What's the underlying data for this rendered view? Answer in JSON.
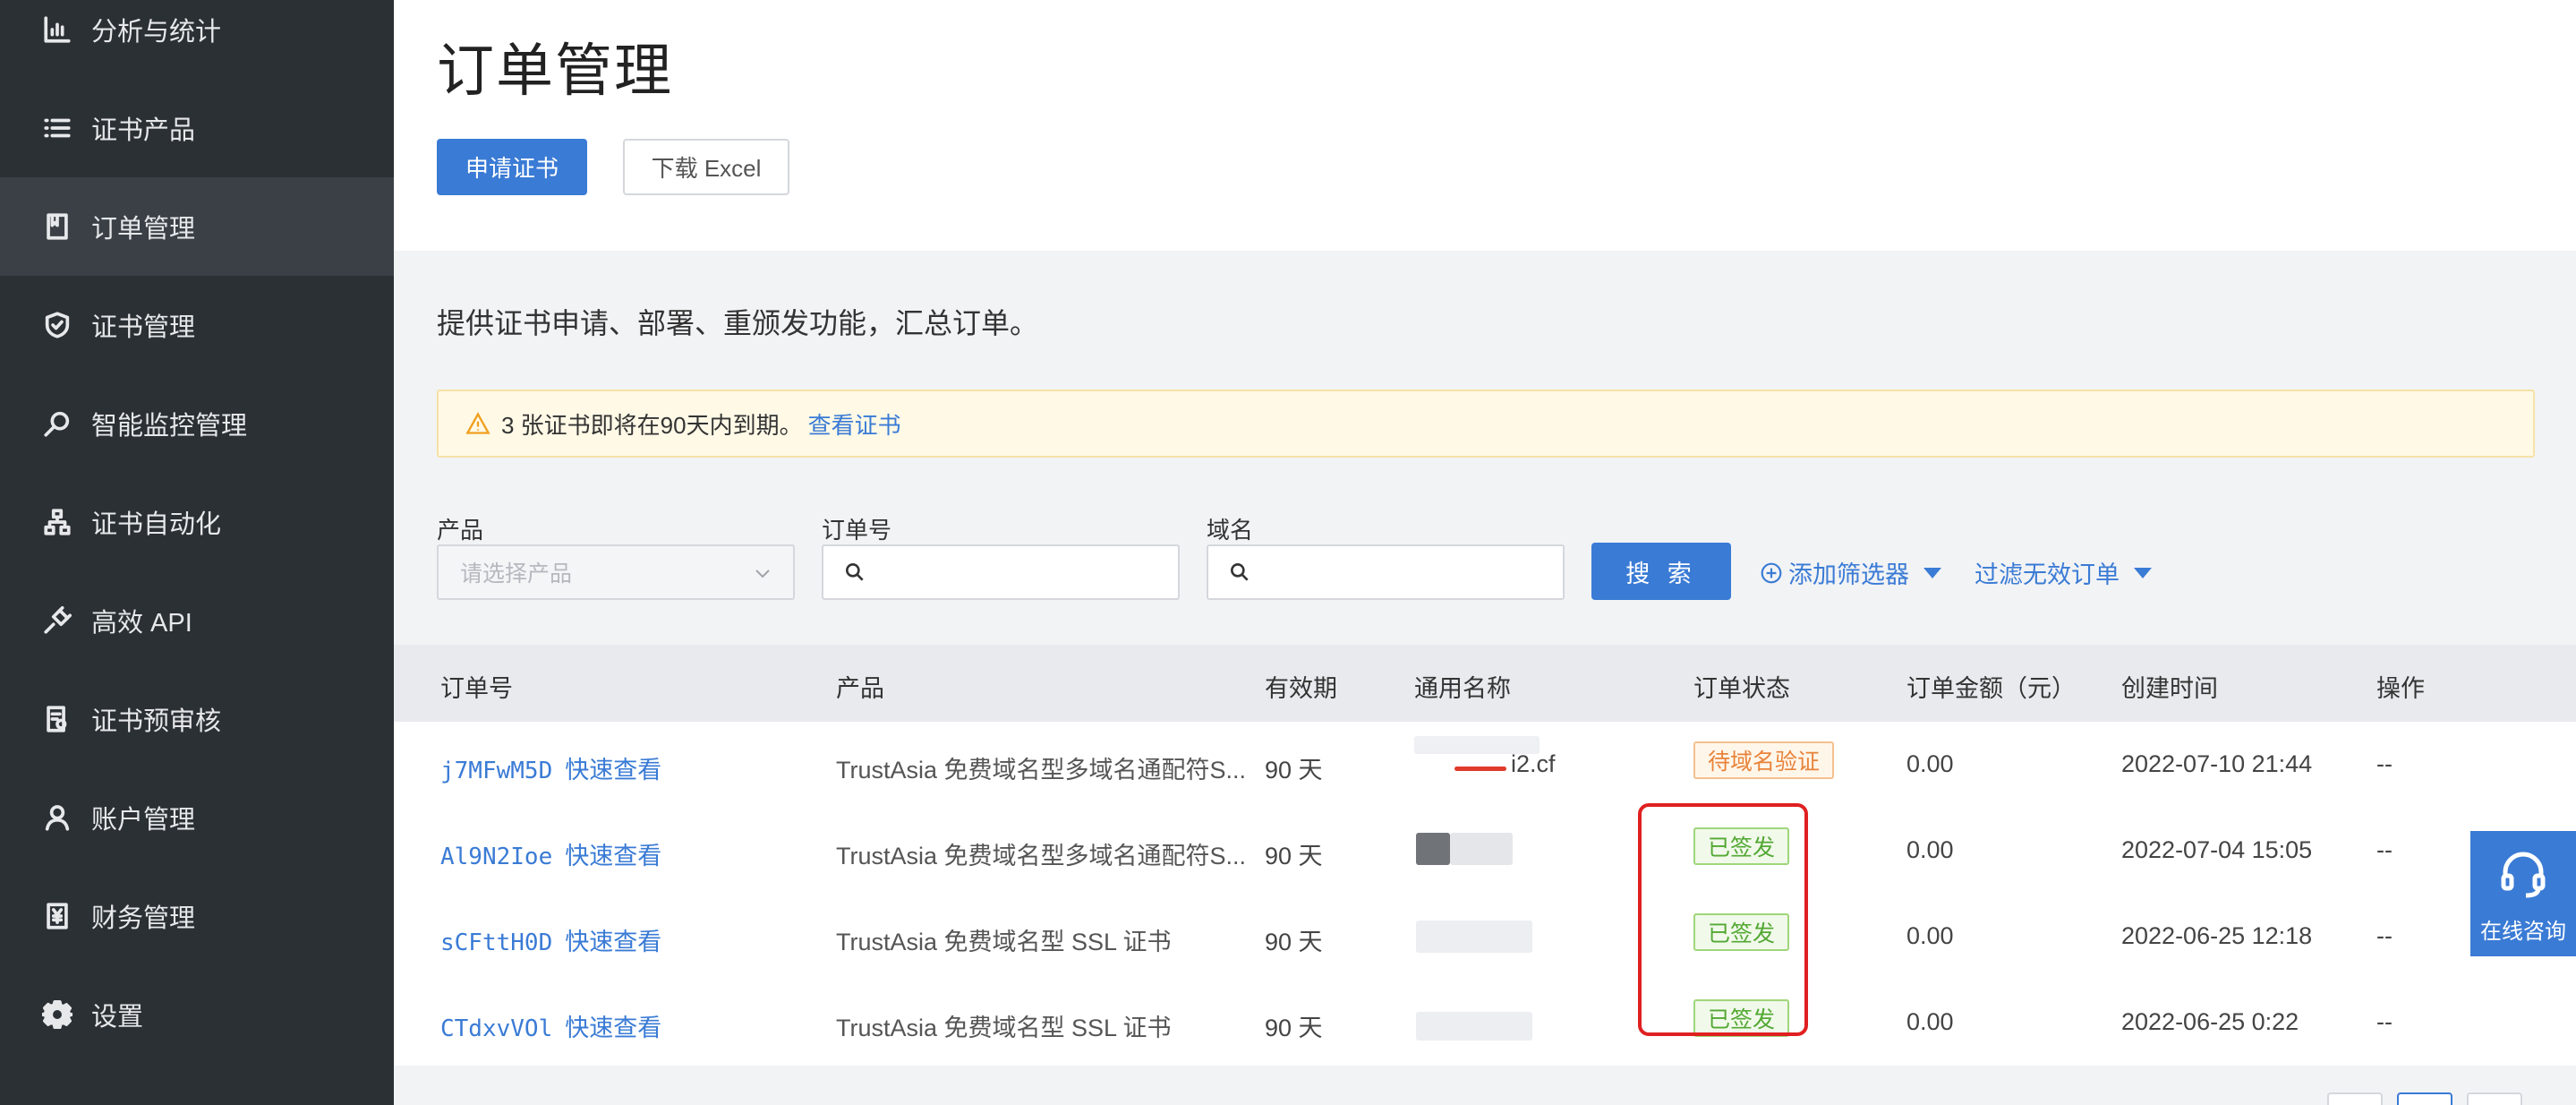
{
  "sidebar": {
    "items": [
      {
        "label": "分析与统计",
        "icon": "bar-chart-icon",
        "active": false
      },
      {
        "label": "证书产品",
        "icon": "list-icon",
        "active": false
      },
      {
        "label": "订单管理",
        "icon": "document-icon",
        "active": true
      },
      {
        "label": "证书管理",
        "icon": "shield-check-icon",
        "active": false
      },
      {
        "label": "智能监控管理",
        "icon": "monitor-search-icon",
        "active": false
      },
      {
        "label": "证书自动化",
        "icon": "sitemap-icon",
        "active": false
      },
      {
        "label": "高效 API",
        "icon": "plug-icon",
        "active": false
      },
      {
        "label": "证书预审核",
        "icon": "doc-check-icon",
        "active": false
      },
      {
        "label": "账户管理",
        "icon": "user-icon",
        "active": false
      },
      {
        "label": "财务管理",
        "icon": "yen-doc-icon",
        "active": false
      },
      {
        "label": "设置",
        "icon": "gear-icon",
        "active": false
      }
    ]
  },
  "header": {
    "title": "订单管理",
    "apply_label": "申请证书",
    "excel_label": "下载 Excel"
  },
  "description": "提供证书申请、部署、重颁发功能，汇总订单。",
  "alert": {
    "text": "3 张证书即将在90天内到期。",
    "link": "查看证书"
  },
  "filters": {
    "product_label": "产品",
    "product_placeholder": "请选择产品",
    "order_label": "订单号",
    "domain_label": "域名",
    "search_label": "搜 索",
    "add_filter_label": "添加筛选器",
    "filter_invalid_label": "过滤无效订单"
  },
  "table": {
    "headers": [
      "订单号",
      "产品",
      "有效期",
      "通用名称",
      "订单状态",
      "订单金额（元）",
      "创建时间",
      "操作"
    ],
    "quick_view": "快速查看",
    "rows": [
      {
        "order": "j7MFwM5D",
        "product": "TrustAsia 免费域名型多域名通配符S...",
        "validity": "90 天",
        "common_name": "i2.cf",
        "status": "待域名验证",
        "status_type": "pending",
        "amount": "0.00",
        "created": "2022-07-10 21:44",
        "action": "--"
      },
      {
        "order": "Al9N2Ioe",
        "product": "TrustAsia 免费域名型多域名通配符S...",
        "validity": "90 天",
        "common_name": "",
        "status": "已签发",
        "status_type": "done",
        "amount": "0.00",
        "created": "2022-07-04 15:05",
        "action": "--"
      },
      {
        "order": "sCFttH0D",
        "product": "TrustAsia 免费域名型 SSL 证书",
        "validity": "90 天",
        "common_name": "",
        "status": "已签发",
        "status_type": "done",
        "amount": "0.00",
        "created": "2022-06-25 12:18",
        "action": "--"
      },
      {
        "order": "CTdxvVOl",
        "product": "TrustAsia 免费域名型 SSL 证书",
        "validity": "90 天",
        "common_name": "",
        "status": "已签发",
        "status_type": "done",
        "amount": "0.00",
        "created": "2022-06-25 0:22",
        "action": "--"
      }
    ]
  },
  "chat": {
    "label": "在线咨询",
    "icon": "headset-icon"
  },
  "colors": {
    "accent": "#3a7bd5",
    "sidebar": "#2b3035",
    "pending": "#e8833a",
    "done": "#52a833",
    "highlight": "#e02020"
  }
}
